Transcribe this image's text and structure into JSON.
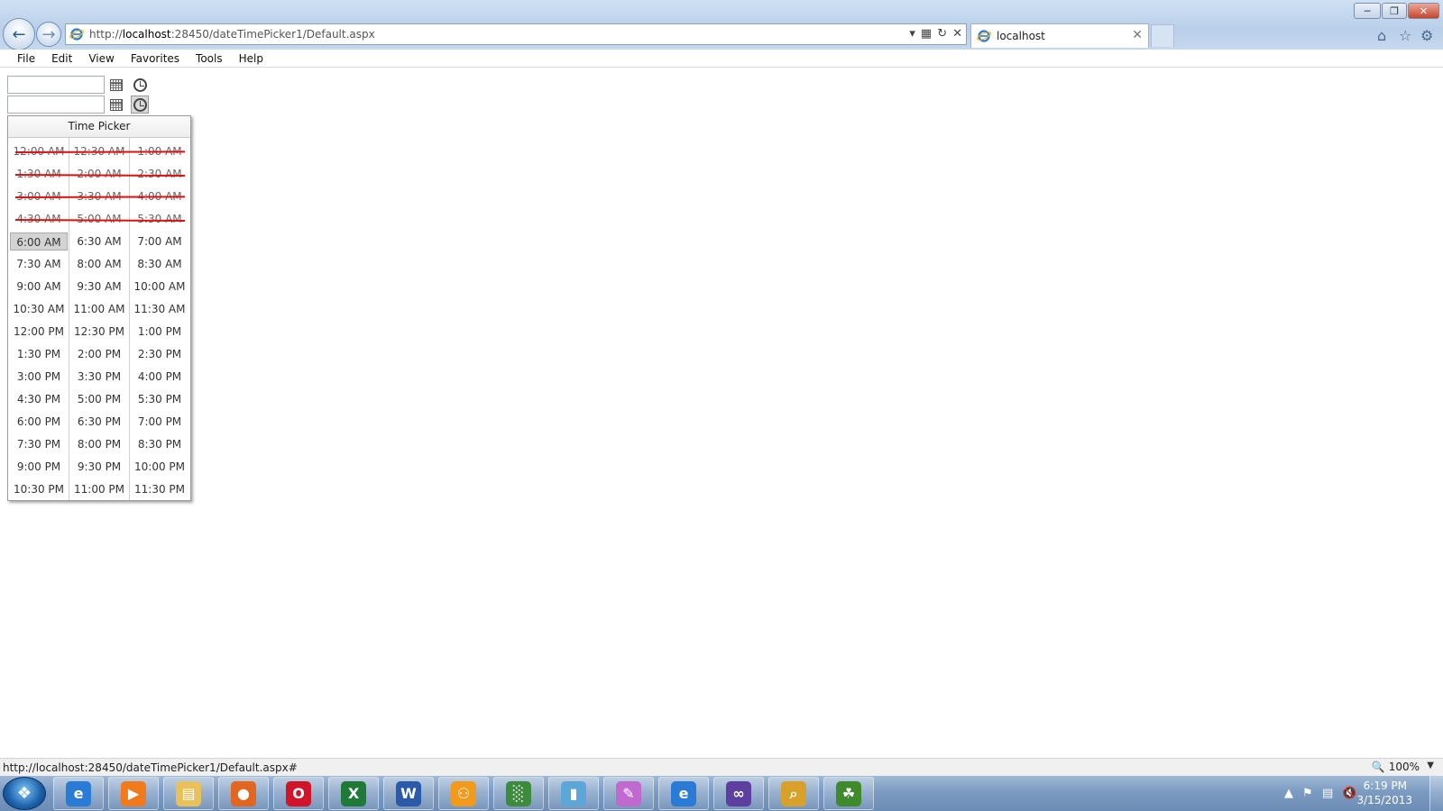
{
  "browser": {
    "address_url_prefix": "http://",
    "address_url_host": "localhost",
    "address_url_rest": ":28450/dateTimePicker1/Default.aspx",
    "tab_title": "localhost",
    "menu": [
      "File",
      "Edit",
      "View",
      "Favorites",
      "Tools",
      "Help"
    ]
  },
  "page": {
    "date_inputs": [
      {
        "value": ""
      },
      {
        "value": ""
      }
    ],
    "time_picker": {
      "title": "Time Picker",
      "selected": "6:00 AM",
      "rows": [
        {
          "cells": [
            "12:00 AM",
            "12:30 AM",
            "1:00 AM"
          ],
          "disabled": true
        },
        {
          "cells": [
            "1:30 AM",
            "2:00 AM",
            "2:30 AM"
          ],
          "disabled": true
        },
        {
          "cells": [
            "3:00 AM",
            "3:30 AM",
            "4:00 AM"
          ],
          "disabled": true
        },
        {
          "cells": [
            "4:30 AM",
            "5:00 AM",
            "5:30 AM"
          ],
          "disabled": true
        },
        {
          "cells": [
            "6:00 AM",
            "6:30 AM",
            "7:00 AM"
          ],
          "disabled": false
        },
        {
          "cells": [
            "7:30 AM",
            "8:00 AM",
            "8:30 AM"
          ],
          "disabled": false
        },
        {
          "cells": [
            "9:00 AM",
            "9:30 AM",
            "10:00 AM"
          ],
          "disabled": false
        },
        {
          "cells": [
            "10:30 AM",
            "11:00 AM",
            "11:30 AM"
          ],
          "disabled": false
        },
        {
          "cells": [
            "12:00 PM",
            "12:30 PM",
            "1:00 PM"
          ],
          "disabled": false
        },
        {
          "cells": [
            "1:30 PM",
            "2:00 PM",
            "2:30 PM"
          ],
          "disabled": false
        },
        {
          "cells": [
            "3:00 PM",
            "3:30 PM",
            "4:00 PM"
          ],
          "disabled": false
        },
        {
          "cells": [
            "4:30 PM",
            "5:00 PM",
            "5:30 PM"
          ],
          "disabled": false
        },
        {
          "cells": [
            "6:00 PM",
            "6:30 PM",
            "7:00 PM"
          ],
          "disabled": false
        },
        {
          "cells": [
            "7:30 PM",
            "8:00 PM",
            "8:30 PM"
          ],
          "disabled": false
        },
        {
          "cells": [
            "9:00 PM",
            "9:30 PM",
            "10:00 PM"
          ],
          "disabled": false
        },
        {
          "cells": [
            "10:30 PM",
            "11:00 PM",
            "11:30 PM"
          ],
          "disabled": false
        }
      ]
    }
  },
  "status_bar": {
    "url": "http://localhost:28450/dateTimePicker1/Default.aspx#",
    "zoom": "100%"
  },
  "taskbar": {
    "apps": [
      "internet-explorer",
      "media-player",
      "file-explorer",
      "firefox",
      "opera",
      "excel",
      "word",
      "app-orange",
      "chart-app",
      "app-blue",
      "paint",
      "internet-explorer",
      "visual-studio",
      "search-app",
      "frog-app"
    ],
    "clock_time": "6:19 PM",
    "clock_date": "3/15/2013"
  },
  "colors": {
    "strike": "#dd1111",
    "selected_cell": "#d3d3d3"
  }
}
